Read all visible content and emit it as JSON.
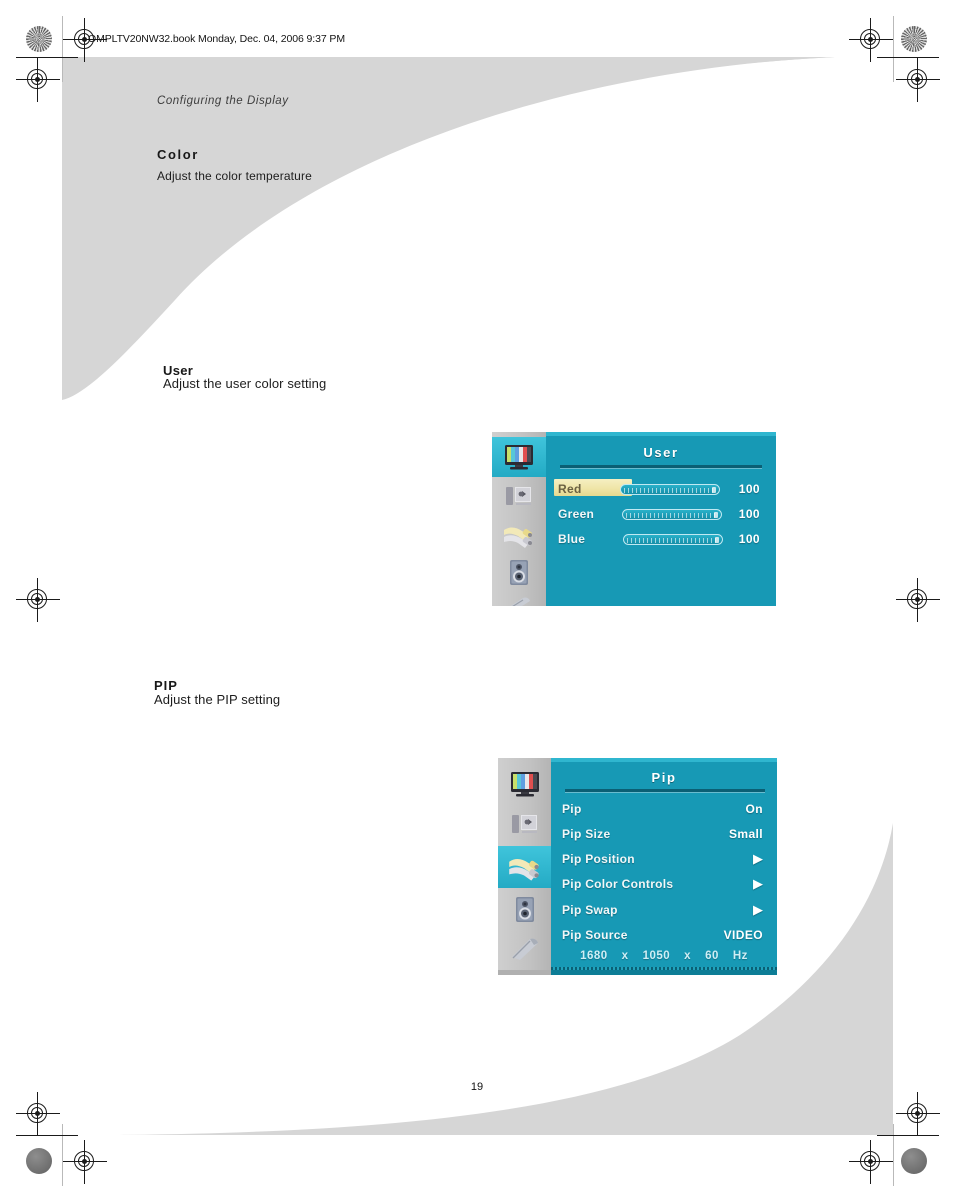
{
  "document": {
    "header_text": "OMPLTV20NW32.book Monday, Dec. 04, 2006  9:37 PM",
    "running_head": "Configuring the Display",
    "page_number": "19"
  },
  "sections": [
    {
      "title": "Color",
      "subtitle": "Adjust the color temperature"
    },
    {
      "title": "User",
      "subtitle": "Adjust the user color setting"
    },
    {
      "title": "PIP",
      "subtitle": "Adjust the PIP setting"
    }
  ],
  "osd_user": {
    "title": "User",
    "sidebar_icons": [
      "picture-icon",
      "display-settings-icon",
      "rca-cable-icon",
      "speaker-icon",
      "tool-wrench-icon"
    ],
    "active_icon_index": 0,
    "rows": [
      {
        "label": "Red",
        "value": "100",
        "selected": true,
        "slider_percent": 100
      },
      {
        "label": "Green",
        "value": "100",
        "selected": false,
        "slider_percent": 100
      },
      {
        "label": "Blue",
        "value": "100",
        "selected": false,
        "slider_percent": 100
      }
    ]
  },
  "osd_pip": {
    "title": "Pip",
    "sidebar_icons": [
      "picture-icon",
      "display-settings-icon",
      "rca-cable-icon",
      "speaker-icon",
      "tool-wrench-icon"
    ],
    "active_icon_index": 2,
    "rows": [
      {
        "label": "Pip",
        "value": "On",
        "type": "value"
      },
      {
        "label": "Pip Size",
        "value": "Small",
        "type": "value"
      },
      {
        "label": "Pip Position",
        "value": "▶",
        "type": "submenu"
      },
      {
        "label": "Pip Color Controls",
        "value": "▶",
        "type": "submenu"
      },
      {
        "label": "Pip Swap",
        "value": "▶",
        "type": "submenu"
      },
      {
        "label": "Pip Source",
        "value": "VIDEO",
        "type": "value"
      }
    ],
    "footer": {
      "width": "1680",
      "sep1": "x",
      "height": "1050",
      "sep2": "x",
      "refresh": "60",
      "unit": "Hz"
    }
  },
  "colors": {
    "osd_background": "#1799b5",
    "osd_highlight": "#3fc4db",
    "row_selected": "#efe5a8",
    "decorative_gray": "#d6d6d6",
    "sidebar_gray": "#c2c2c2"
  }
}
